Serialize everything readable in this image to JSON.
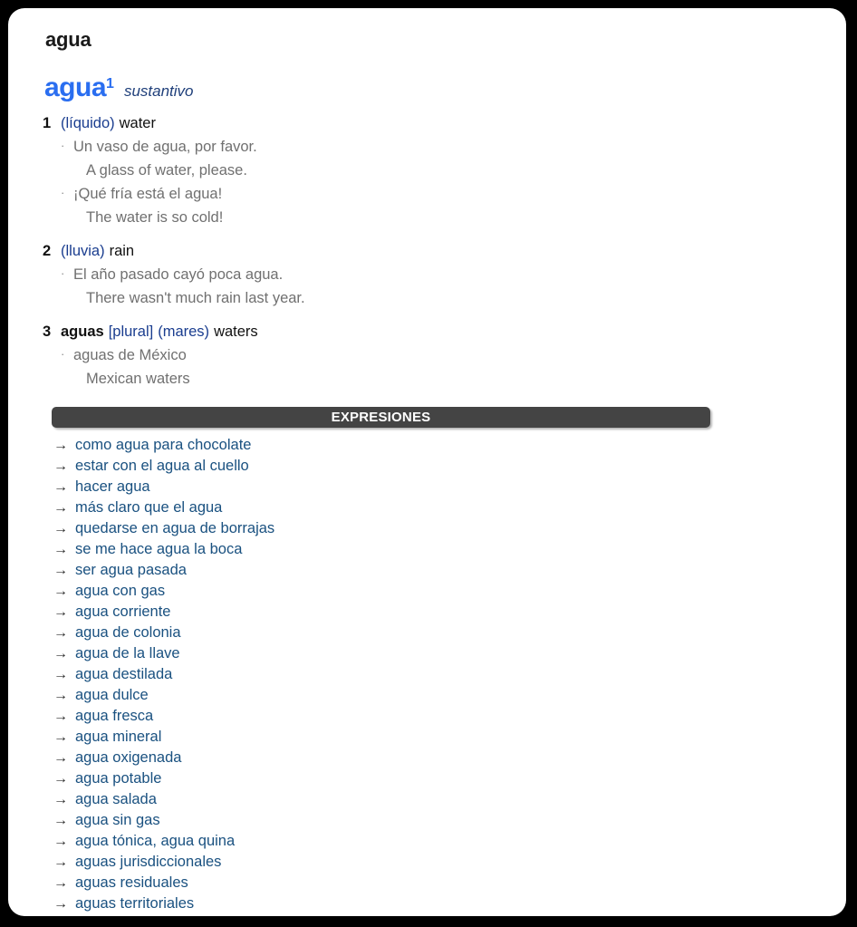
{
  "entry": {
    "title": "agua",
    "headword": "agua",
    "homograph_number": "1",
    "part_of_speech": "sustantivo"
  },
  "senses": [
    {
      "number": "1",
      "lemma": "",
      "grammar": "",
      "domain": "(líquido)",
      "translation": "water",
      "examples": [
        {
          "bullet": "·",
          "source": "Un vaso de agua, por favor.",
          "target": "A glass of water, please."
        },
        {
          "bullet": "·",
          "source": "¡Qué fría está el agua!",
          "target": "The water is so cold!"
        }
      ]
    },
    {
      "number": "2",
      "lemma": "",
      "grammar": "",
      "domain": "(lluvia)",
      "translation": "rain",
      "examples": [
        {
          "bullet": "·",
          "source": "El año pasado cayó poca agua.",
          "target": "There wasn't much rain last year."
        }
      ]
    },
    {
      "number": "3",
      "lemma": "aguas",
      "grammar": "[plural]",
      "domain": "(mares)",
      "translation": "waters",
      "examples": [
        {
          "bullet": "·",
          "source": "aguas de México",
          "target": "Mexican waters"
        }
      ]
    }
  ],
  "expressions_section": {
    "heading": "EXPRESIONES",
    "arrow": "→",
    "items": [
      {
        "label": "como agua para chocolate"
      },
      {
        "label": "estar con el agua al cuello"
      },
      {
        "label": "hacer agua"
      },
      {
        "label": "más claro que el agua"
      },
      {
        "label": "quedarse en agua de borrajas"
      },
      {
        "label": "se me hace agua la boca"
      },
      {
        "label": "ser agua pasada"
      },
      {
        "label": "agua con gas"
      },
      {
        "label": "agua corriente"
      },
      {
        "label": "agua de colonia"
      },
      {
        "label": "agua de la llave"
      },
      {
        "label": "agua destilada"
      },
      {
        "label": "agua dulce"
      },
      {
        "label": "agua fresca"
      },
      {
        "label": "agua mineral"
      },
      {
        "label": "agua oxigenada"
      },
      {
        "label": "agua potable"
      },
      {
        "label": "agua salada"
      },
      {
        "label": "agua sin gas"
      },
      {
        "label": "agua tónica, agua quina"
      },
      {
        "label": "aguas jurisdiccionales"
      },
      {
        "label": "aguas residuales"
      },
      {
        "label": "aguas territoriales"
      }
    ]
  },
  "colors": {
    "headword_blue": "#2a6ef0",
    "label_blue": "#1a3d8f",
    "link_blue": "#1a5180",
    "example_gray": "#707070",
    "bar_gray": "#444444",
    "frame_black": "#000000"
  }
}
